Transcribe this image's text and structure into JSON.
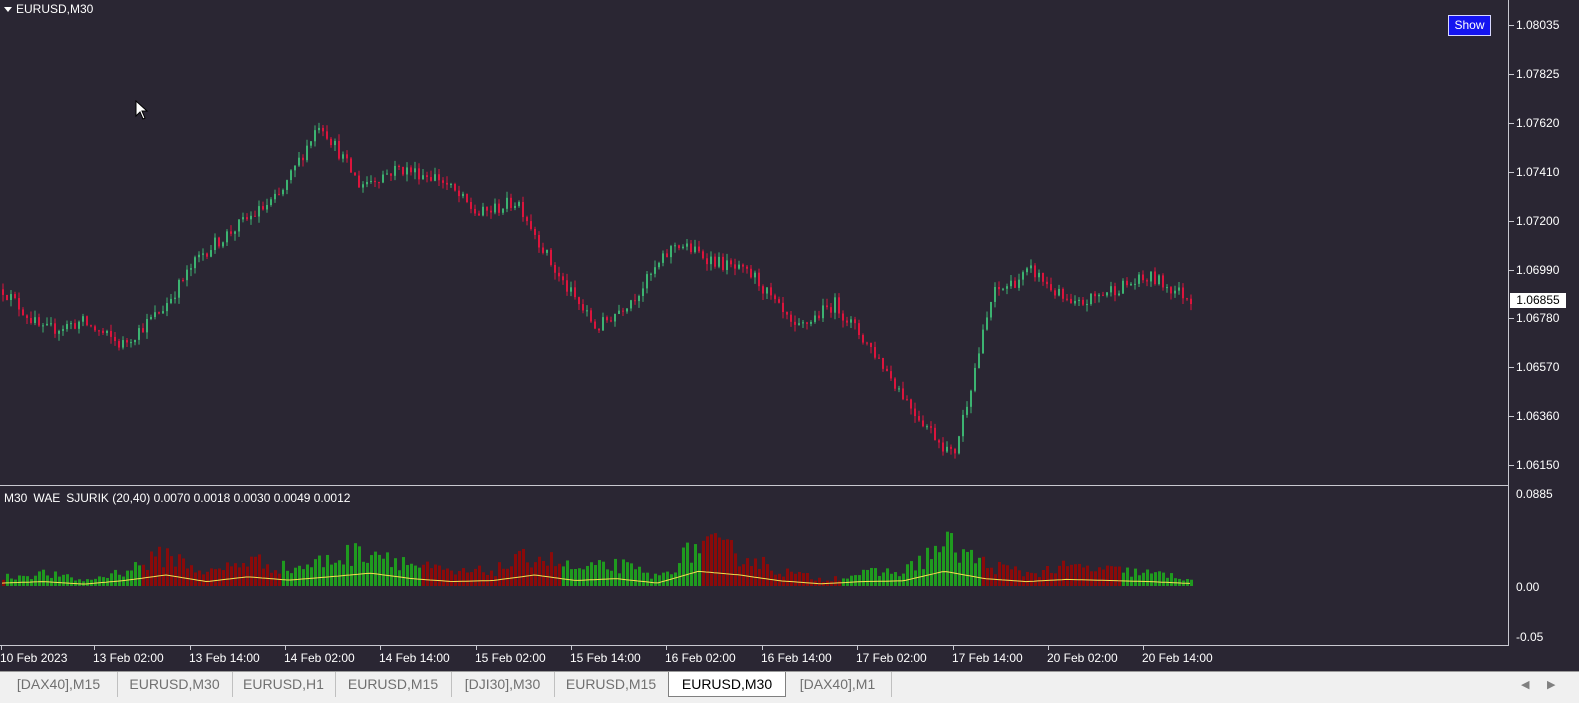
{
  "chart": {
    "title": "EURUSD,M30",
    "show_button": "Show",
    "current_price": "1.06855",
    "price_labels": [
      "1.08035",
      "1.07825",
      "1.07620",
      "1.07410",
      "1.07200",
      "1.06990",
      "1.06780",
      "1.06570",
      "1.06360",
      "1.06150"
    ],
    "colors": {
      "background": "#2a2633",
      "bull": "#3cb371",
      "bear": "#dc143c",
      "grid": "#c8c8d0"
    }
  },
  "indicator": {
    "name": "M30",
    "label": "WAE",
    "params": "SJURIK (20,40) 0.0070 0.0018 0.0030 0.0049 0.0012",
    "scale_labels": [
      "0.0885",
      "0.00",
      "-0.05"
    ],
    "colors": {
      "up": "#1f9a1f",
      "down": "#8b0a0a",
      "signal": "#f0e050"
    }
  },
  "time_axis": [
    "10 Feb 2023",
    "13 Feb 02:00",
    "13 Feb 14:00",
    "14 Feb 02:00",
    "14 Feb 14:00",
    "15 Feb 02:00",
    "15 Feb 14:00",
    "16 Feb 02:00",
    "16 Feb 14:00",
    "17 Feb 02:00",
    "17 Feb 14:00",
    "20 Feb 02:00",
    "20 Feb 14:00"
  ],
  "tabs": [
    "[DAX40],M15",
    "EURUSD,M30",
    "EURUSD,H1",
    "EURUSD,M15",
    "[DJI30],M30",
    "EURUSD,M15",
    "EURUSD,M30",
    "[DAX40],M1"
  ],
  "active_tab": 6,
  "chart_data": {
    "type": "candlestick",
    "x": [
      "10 Feb 2023",
      "13 Feb 02:00",
      "13 Feb 14:00",
      "14 Feb 02:00",
      "14 Feb 14:00",
      "15 Feb 02:00",
      "15 Feb 14:00",
      "16 Feb 02:00",
      "16 Feb 14:00",
      "17 Feb 02:00",
      "17 Feb 14:00",
      "20 Feb 02:00",
      "20 Feb 14:00"
    ],
    "close_path": [
      1.069,
      1.0672,
      1.0676,
      1.0666,
      1.0681,
      1.0705,
      1.0718,
      1.073,
      1.0762,
      1.0735,
      1.0742,
      1.0738,
      1.0722,
      1.0728,
      1.0696,
      1.0673,
      1.0688,
      1.071,
      1.0702,
      1.0695,
      1.0672,
      1.0684,
      1.0663,
      1.0638,
      1.0618,
      1.0688,
      1.0698,
      1.0682,
      1.069,
      1.0695,
      1.0686
    ],
    "indicator_path": [
      0.008,
      0.012,
      0.005,
      0.015,
      0.03,
      0.012,
      0.025,
      0.016,
      0.025,
      0.035,
      0.02,
      0.012,
      0.015,
      0.03,
      0.015,
      0.02,
      0.008,
      0.04,
      0.03,
      0.014,
      0.006,
      0.012,
      0.014,
      0.04,
      0.02,
      0.012,
      0.018,
      0.015,
      0.012,
      0.007
    ]
  }
}
